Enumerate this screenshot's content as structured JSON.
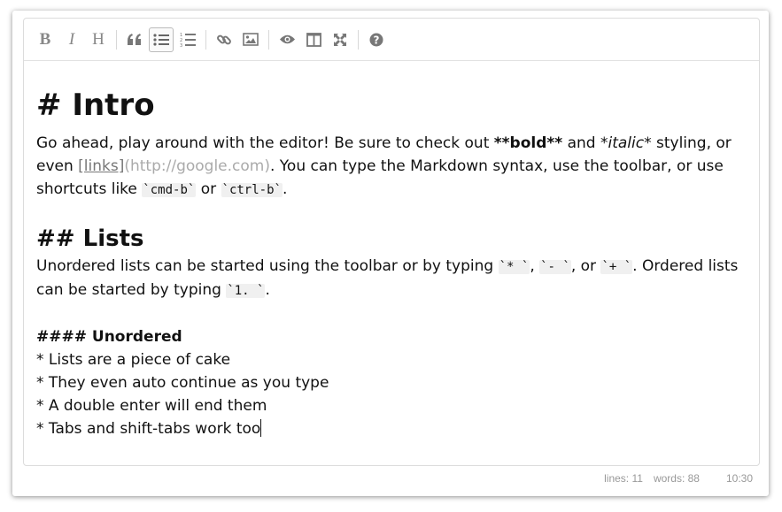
{
  "toolbar": {
    "bold": "B",
    "italic": "I",
    "heading": "H"
  },
  "content": {
    "h1": "# Intro",
    "p1": {
      "t1": "Go ahead, play around with the editor! Be sure to check out ",
      "bold": "**bold**",
      "t2": " and ",
      "italic": "*italic*",
      "t3": " styling, or even ",
      "link": "[links]",
      "url": "(http://google.com)",
      "t4": ". You can type the Markdown syntax, use the toolbar, or use shortcuts like ",
      "code1": "`cmd-b`",
      "t5": " or ",
      "code2": "`ctrl-b`",
      "t6": "."
    },
    "h2": "## Lists",
    "p2": {
      "t1": "Unordered lists can be started using the toolbar or by typing ",
      "code1": "`* `",
      "t2": ", ",
      "code2": "`- `",
      "t3": ", or ",
      "code3": "`+ `",
      "t4": ". Ordered lists can be started by typing ",
      "code4": "`1. `",
      "t5": "."
    },
    "h4": "#### Unordered",
    "items": [
      "* Lists are a piece of cake",
      "* They even auto continue as you type",
      "* A double enter will end them",
      "* Tabs and shift-tabs work too"
    ]
  },
  "status": {
    "lines": "lines: 11",
    "words": "words: 88",
    "time": "10:30"
  }
}
